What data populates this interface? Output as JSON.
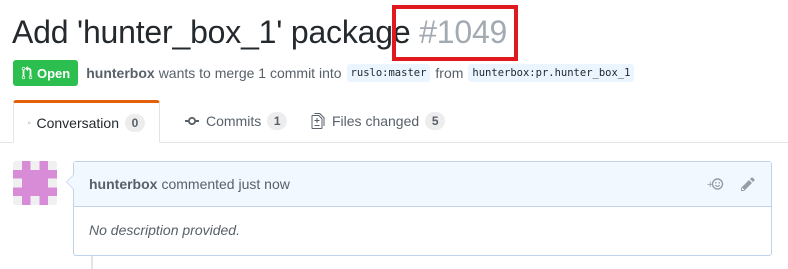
{
  "pr": {
    "title": "Add 'hunter_box_1' package",
    "number": "#1049",
    "state": "Open",
    "author": "hunterbox",
    "merge_text": "wants to merge 1 commit into",
    "base_branch": "ruslo:master",
    "from_text": "from",
    "head_branch": "hunterbox:pr.hunter_box_1"
  },
  "tabs": [
    {
      "label": "Conversation",
      "count": "0",
      "icon": "comment-discussion-icon"
    },
    {
      "label": "Commits",
      "count": "1",
      "icon": "git-commit-icon"
    },
    {
      "label": "Files changed",
      "count": "5",
      "icon": "file-diff-icon"
    }
  ],
  "comment": {
    "author": "hunterbox",
    "action": "commented just now",
    "body": "No description provided."
  },
  "colors": {
    "open_badge": "#2cbe4e",
    "highlight": "#e0191f",
    "selected_tab_accent": "#e36209",
    "avatar": "#d88bd7"
  }
}
